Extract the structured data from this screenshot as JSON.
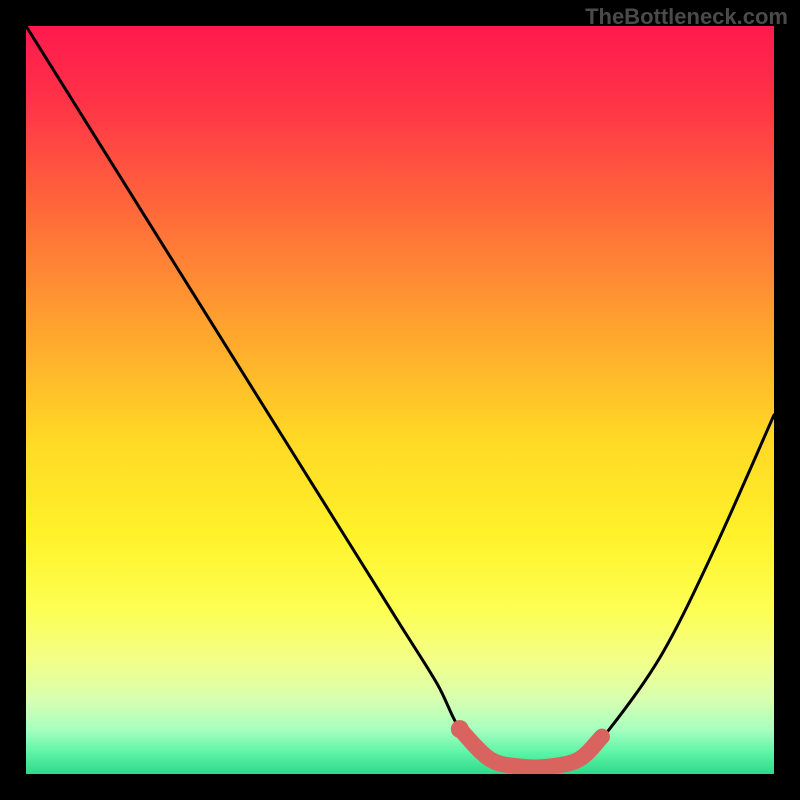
{
  "watermark": "TheBottleneck.com",
  "colors": {
    "black": "#000000",
    "curve": "#000000",
    "highlight": "#d9635f",
    "gradient_stops": [
      {
        "offset": 0.0,
        "color": "#ff1a4e"
      },
      {
        "offset": 0.1,
        "color": "#ff3247"
      },
      {
        "offset": 0.25,
        "color": "#ff6a3a"
      },
      {
        "offset": 0.4,
        "color": "#ffa22f"
      },
      {
        "offset": 0.55,
        "color": "#ffd825"
      },
      {
        "offset": 0.68,
        "color": "#fff22a"
      },
      {
        "offset": 0.78,
        "color": "#fdff53"
      },
      {
        "offset": 0.85,
        "color": "#f2ff8a"
      },
      {
        "offset": 0.9,
        "color": "#d8ffb0"
      },
      {
        "offset": 0.94,
        "color": "#a8ffc0"
      },
      {
        "offset": 0.97,
        "color": "#60f5a8"
      },
      {
        "offset": 1.0,
        "color": "#2fd98a"
      }
    ]
  },
  "chart_data": {
    "type": "line",
    "title": "",
    "xlabel": "",
    "ylabel": "",
    "xlim": [
      0,
      100
    ],
    "ylim": [
      0,
      100
    ],
    "series": [
      {
        "name": "bottleneck-curve",
        "x": [
          0,
          5,
          10,
          15,
          20,
          25,
          30,
          35,
          40,
          45,
          50,
          55,
          58,
          62,
          66,
          70,
          74,
          78,
          85,
          92,
          100
        ],
        "y": [
          100,
          92,
          84,
          76,
          68,
          60,
          52,
          44,
          36,
          28,
          20,
          12,
          6,
          2,
          1,
          1,
          2,
          6,
          16,
          30,
          48
        ]
      },
      {
        "name": "optimal-range-highlight",
        "x": [
          58,
          62,
          66,
          70,
          74,
          77
        ],
        "y": [
          6,
          2,
          1,
          1,
          2,
          5
        ]
      }
    ],
    "annotations": []
  }
}
